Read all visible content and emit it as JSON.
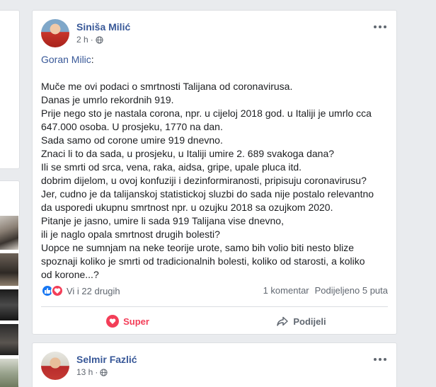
{
  "post": {
    "author": "Siniša Milić",
    "time": "2 h",
    "quoted_name": "Goran Milic",
    "quoted_suffix": ":",
    "lines": [
      "Muče me ovi podaci o smrtnosti Talijana od coronavirusa.",
      "Danas je umrlo rekordnih 919.",
      "Prije nego sto je nastala corona, npr. u cijeloj 2018 god. u Italiji je umrlo cca",
      "647.000 osoba. U prosjeku, 1770 na dan.",
      "Sada samo od corone umire 919 dnevno.",
      "Znaci li to da sada, u prosjeku, u Italiji umire 2. 689 svakoga dana?",
      "Ili se smrti od srca, vena, raka, aidsa, gripe, upale pluca itd.",
      "dobrim dijelom, u ovoj konfuziji i dezinformiranosti, pripisuju coronavirusu?",
      "Jer, cudno je da talijanskoj statistickoj sluzbi do sada nije postalo relevantno",
      "da usporedi ukupnu smrtnost npr. u ozujku 2018 sa ozujkom 2020.",
      "Pitanje je jasno, umire li sada 919 Talijana vise dnevno,",
      "ili je naglo opala smrtnost drugih bolesti?",
      "Uopce ne sumnjam na neke teorije urote, samo bih volio biti nesto blize",
      "spoznaji koliko je smrti od tradicionalnih bolesti, koliko od starosti, a koliko",
      "od korone...?"
    ],
    "reactions_text": "Vi i 22 drugih",
    "comments_text": "1 komentar",
    "shares_text": "Podijeljeno 5 puta",
    "action_react": "Super",
    "action_share": "Podijeli"
  },
  "next_post": {
    "author": "Selmir Fazlić",
    "time": "13 h"
  },
  "colors": {
    "link": "#385898",
    "love": "#f33e58",
    "like": "#1877f2"
  }
}
